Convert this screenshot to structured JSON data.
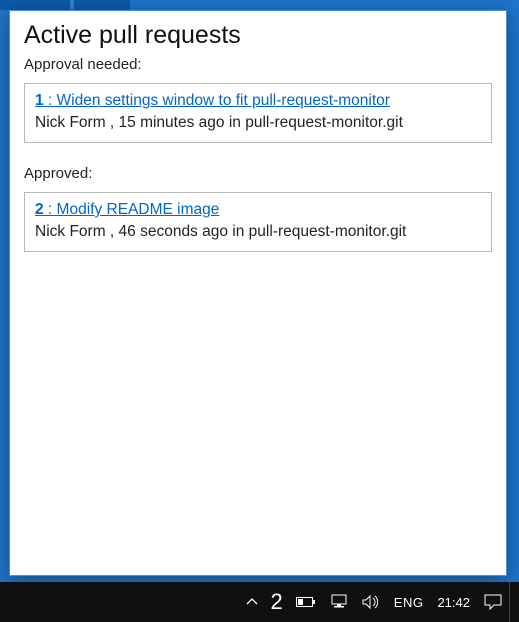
{
  "window": {
    "title": "Active pull requests",
    "sections": [
      {
        "label": "Approval needed:",
        "items": [
          {
            "number": "1",
            "title_sep": " : ",
            "title": "Widen settings window to fit pull-request-monitor",
            "author": "Nick Form",
            "time": "15 minutes ago",
            "repo": "pull-request-monitor.git"
          }
        ]
      },
      {
        "label": "Approved:",
        "items": [
          {
            "number": "2",
            "title_sep": " : ",
            "title": "Modify README image",
            "author": "Nick Form",
            "time": "46 seconds ago",
            "repo": "pull-request-monitor.git"
          }
        ]
      }
    ]
  },
  "taskbar": {
    "tray_count": "2",
    "language": "ENG",
    "clock": "21:42"
  }
}
